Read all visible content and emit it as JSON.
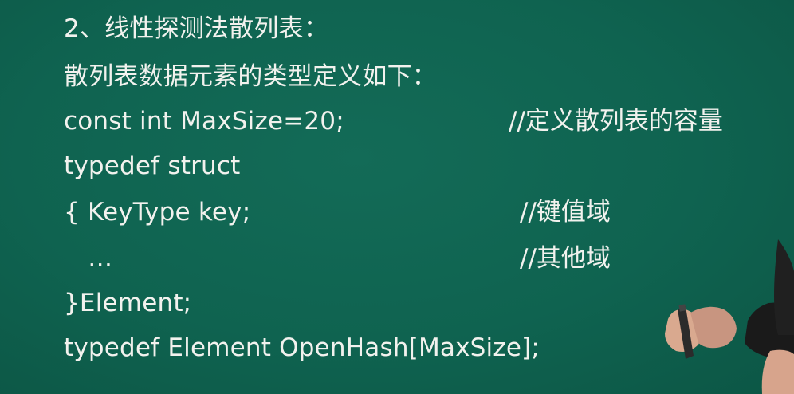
{
  "slide": {
    "heading": "2、线性探测法散列表：",
    "intro": "散列表数据元素的类型定义如下：",
    "code": [
      {
        "text": "const int MaxSize=20;",
        "comment": "//定义散列表的容量"
      },
      {
        "text": "typedef struct",
        "comment": ""
      },
      {
        "text": "{ KeyType key;",
        "comment": "//键值域"
      },
      {
        "text": "   …",
        "comment": "//其他域"
      },
      {
        "text": "}Element;",
        "comment": ""
      },
      {
        "text": "typedef Element OpenHash[MaxSize];",
        "comment": ""
      }
    ]
  },
  "colors": {
    "board": "#0f6350",
    "chalk_text": "#f2f2ee"
  }
}
